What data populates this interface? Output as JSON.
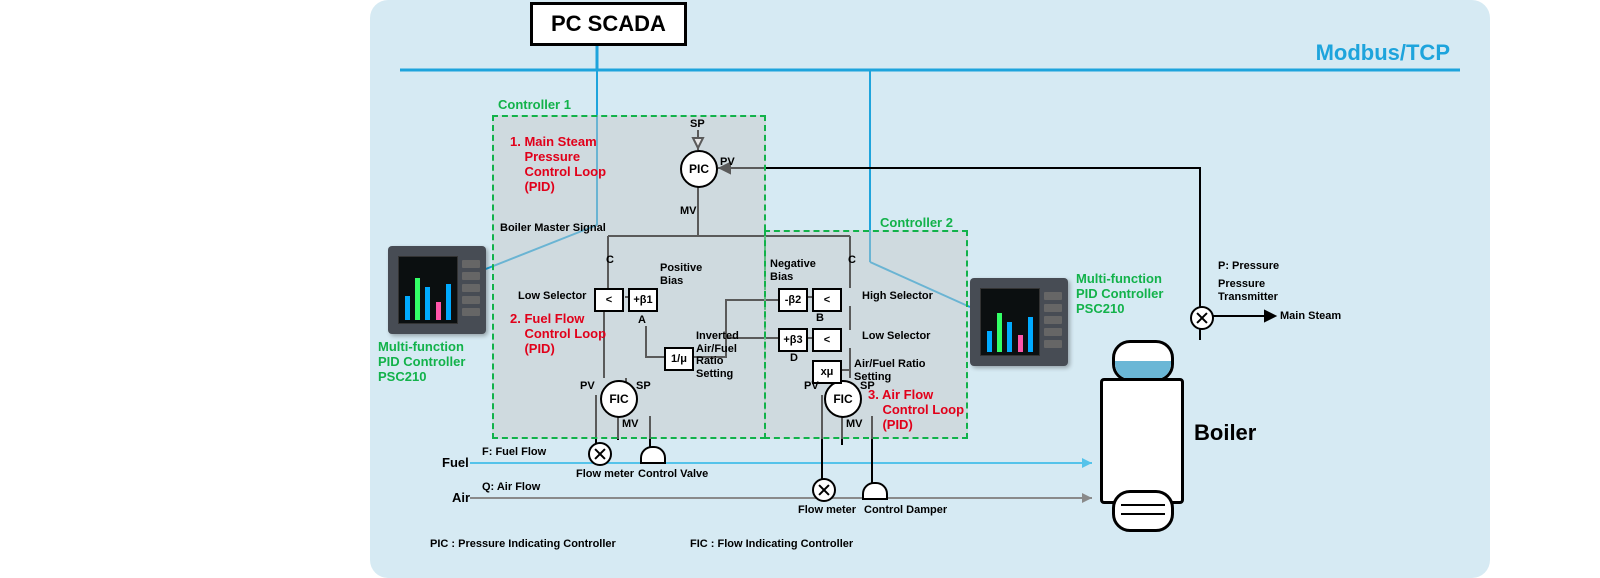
{
  "header": {
    "scada": "PC SCADA",
    "bus": "Modbus/TCP"
  },
  "controllers": {
    "c1_title": "Controller 1",
    "c2_title": "Controller 2",
    "device_label": "Multi-function\nPID Controller\nPSC210"
  },
  "loops": {
    "l1": "1. Main Steam\n    Pressure\n    Control Loop\n    (PID)",
    "l2": "2. Fuel Flow\n    Control Loop\n    (PID)",
    "l3": "3. Air Flow\n    Control Loop\n    (PID)"
  },
  "tags": {
    "sp": "SP",
    "pv": "PV",
    "mv": "MV",
    "bms": "Boiler Master Signal",
    "c": "C",
    "a": "A",
    "b": "B",
    "d": "D",
    "pos_bias": "Positive\nBias",
    "neg_bias": "Negative\nBias",
    "low_sel": "Low Selector",
    "high_sel": "High Selector",
    "inv_ratio": "Inverted\nAir/Fuel\nRatio\nSetting",
    "ratio": "Air/Fuel Ratio\nSetting",
    "fuel": "Fuel",
    "air": "Air",
    "f_def": "F: Fuel Flow",
    "q_def": "Q: Air Flow",
    "p_def": "P: Pressure",
    "flow_meter": "Flow meter",
    "ctrl_valve": "Control Valve",
    "ctrl_damper": "Control Damper",
    "press_tx": "Pressure\nTransmitter",
    "main_steam": "Main Steam",
    "boiler": "Boiler"
  },
  "nodes": {
    "pic": "PIC",
    "fic": "FIC",
    "lt": "<",
    "b1": "+β1",
    "b2": "-β2",
    "b3": "+β3",
    "inv": "1/μ",
    "mu": "xμ"
  },
  "legend": {
    "pic": "PIC : Pressure Indicating Controller",
    "fic": "FIC : Flow Indicating Controller"
  },
  "colors": {
    "bus": "#1ea4dc",
    "ctrl": "#12b24a",
    "loop": "#e1001a"
  }
}
